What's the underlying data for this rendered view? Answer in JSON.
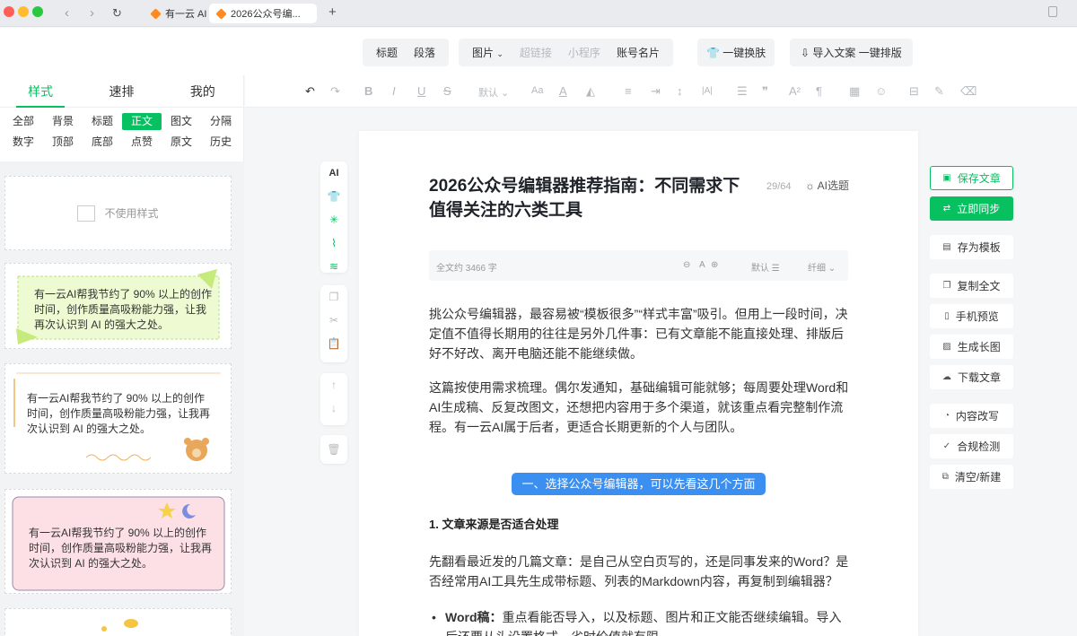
{
  "browser": {
    "tabs": [
      {
        "label": "有一云 AI"
      },
      {
        "label": "2026公众号编..."
      }
    ]
  },
  "toolbar": {
    "group1": [
      "标题",
      "段落"
    ],
    "group2": [
      {
        "label": "图片",
        "disabled": false,
        "dropdown": true
      },
      {
        "label": "超链接",
        "disabled": true
      },
      {
        "label": "小程序",
        "disabled": true
      },
      {
        "label": "账号名片",
        "disabled": false
      }
    ],
    "skin_label": "一键换肤",
    "import_label": "导入文案 一键排版"
  },
  "sidebar": {
    "tabs": [
      {
        "label": "样式",
        "active": true
      },
      {
        "label": "速排",
        "active": false
      },
      {
        "label": "我的",
        "active": false
      }
    ],
    "categories": [
      {
        "label": "全部"
      },
      {
        "label": "背景"
      },
      {
        "label": "标题"
      },
      {
        "label": "正文",
        "active": true
      },
      {
        "label": "图文"
      },
      {
        "label": "分隔"
      },
      {
        "label": "数字"
      },
      {
        "label": "顶部"
      },
      {
        "label": "底部"
      },
      {
        "label": "点赞"
      },
      {
        "label": "原文"
      },
      {
        "label": "历史"
      }
    ],
    "no_style_label": "不使用样式",
    "samples": [
      "有一云AI帮我节约了 90% 以上的创作时间，创作质量高吸粉能力强，让我再次认识到 AI 的强大之处。",
      "有一云AI帮我节约了 90% 以上的创作时间，创作质量高吸粉能力强，让我再次认识到 AI 的强大之处。",
      "有一云AI帮我节约了 90% 以上的创作时间，创作质量高吸粉能力强，让我再次认识到 AI 的强大之处。"
    ]
  },
  "editor": {
    "font_default": "默认",
    "float_ai_label": "AI"
  },
  "article": {
    "title": "2026公众号编辑器推荐指南：不同需求下值得关注的六类工具",
    "title_count": "29/64",
    "ai_topic_label": "AI选题",
    "word_count": "全文约 3466 字",
    "font_size_label": "A",
    "line_height_label": "默认",
    "style_label": "纤细",
    "paragraphs": [
      "挑公众号编辑器，最容易被“模板很多”“样式丰富”吸引。但用上一段时间，决定值不值得长期用的往往是另外几件事：已有文章能不能直接处理、排版后好不好改、离开电脑还能不能继续做。",
      "这篇按使用需求梳理。偶尔发通知，基础编辑可能就够；每周要处理Word和AI生成稿、反复改图文，还想把内容用于多个渠道，就该重点看完整制作流程。有一云AI属于后者，更适合长期更新的个人与团队。"
    ],
    "section_heading": "一、选择公众号编辑器，可以先看这几个方面",
    "subheading": "1. 文章来源是否适合处理",
    "para3": "先翻看最近发的几篇文章：是自己从空白页写的，还是同事发来的Word？是否经常用AI工具先生成带标题、列表的Markdown内容，再复制到编辑器？",
    "bullet_label": "Word稿：",
    "bullet_text": "重点看能否导入，以及标题、图片和正文能否继续编辑。导入后还要从头设置格式，省时价值就有限。"
  },
  "actions": [
    {
      "label": "保存文章",
      "icon": "save-icon",
      "kind": "save"
    },
    {
      "label": "立即同步",
      "icon": "sync-icon",
      "kind": "sync"
    },
    {
      "label": "存为模板",
      "icon": "template-icon"
    },
    {
      "label": "复制全文",
      "icon": "copy-icon"
    },
    {
      "label": "手机预览",
      "icon": "phone-icon"
    },
    {
      "label": "生成长图",
      "icon": "image-icon"
    },
    {
      "label": "下载文章",
      "icon": "download-icon"
    },
    {
      "label": "内容改写",
      "icon": "rewrite-icon"
    },
    {
      "label": "合规检测",
      "icon": "check-icon"
    },
    {
      "label": "清空/新建",
      "icon": "new-icon"
    }
  ],
  "colors": {
    "accent": "#07c160",
    "section": "#3b8ff0"
  }
}
